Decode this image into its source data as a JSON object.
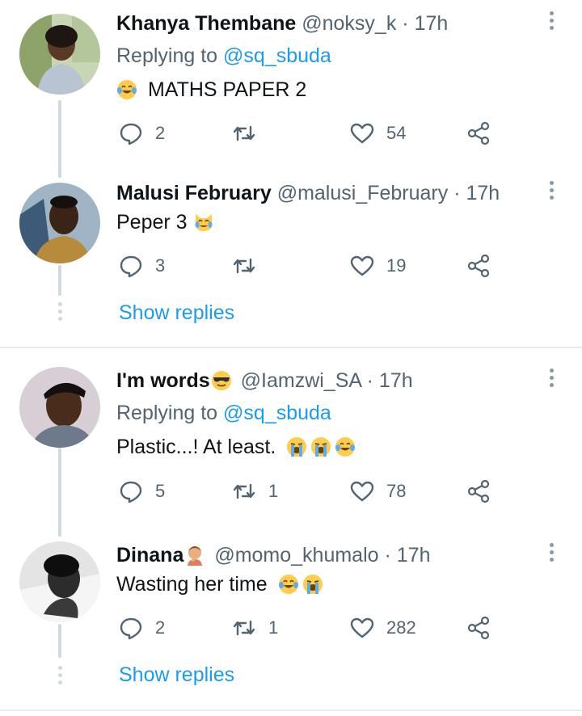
{
  "tweets": [
    {
      "name": "Khanya Thembane",
      "handle": "@noksy_k",
      "dot": "·",
      "time": "17h",
      "replying_label": "Replying to",
      "replying_handle": "@sq_sbuda",
      "text": "MATHS PAPER 2",
      "text_emoji": "face-with-tears-of-joy",
      "replies": "2",
      "retweets": "",
      "likes": "54"
    },
    {
      "name": "Malusi February",
      "handle": "@malusi_February",
      "dot": "·",
      "time": "17h",
      "text": "Peper 3",
      "text_emoji": "crying-cat-face",
      "replies": "3",
      "retweets": "",
      "likes": "19"
    },
    {
      "name": "I'm words",
      "name_emoji": "smiling-face-with-sunglasses",
      "handle": "@Iamzwi_SA",
      "dot": "·",
      "time": "17h",
      "replying_label": "Replying to",
      "replying_handle": "@sq_sbuda",
      "text": "Plastic...! At least.",
      "text_emoji": "loudly-crying-face x2, face-with-tears-of-joy",
      "replies": "5",
      "retweets": "1",
      "likes": "78"
    },
    {
      "name": "Dinana",
      "name_emoji": "person-facepalming",
      "handle": "@momo_khumalo",
      "dot": "·",
      "time": "17h",
      "text": "Wasting her time",
      "text_emoji": "face-with-tears-of-joy, loudly-crying-face",
      "replies": "2",
      "retweets": "1",
      "likes": "282"
    }
  ],
  "show_replies_label": "Show replies",
  "colors": {
    "link": "#1d9bf0",
    "secondary": "#536471",
    "line": "#cfd9de"
  }
}
